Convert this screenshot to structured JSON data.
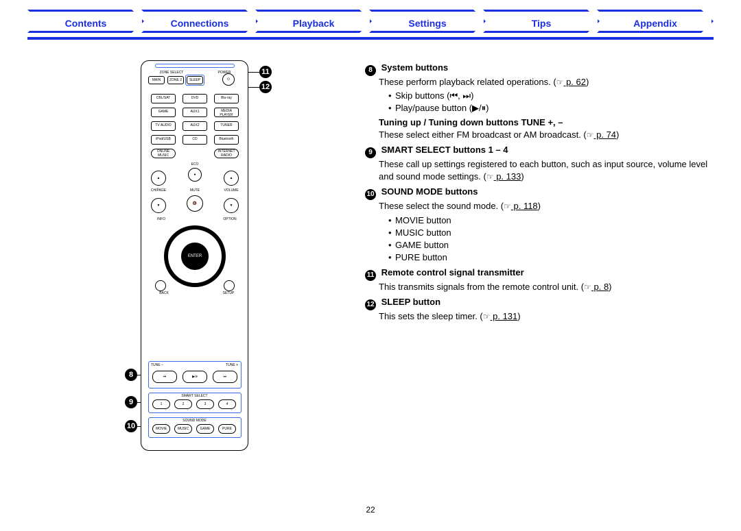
{
  "nav": {
    "contents": "Contents",
    "connections": "Connections",
    "playback": "Playback",
    "settings": "Settings",
    "tips": "Tips",
    "appendix": "Appendix"
  },
  "callout": {
    "n8": "8",
    "n9": "9",
    "n10": "10",
    "n11": "11",
    "n12": "12"
  },
  "desc": {
    "i8_title": "System buttons",
    "i8_line1a": "These perform playback related operations.  (",
    "i8_link": " p. 62",
    "i8_line1b": ")",
    "i8_b1": "Skip buttons (⏮, ⏭)",
    "i8_b2": "Play/pause button (▶/⏸)",
    "tune_title": "Tuning up / Tuning down buttons TUNE +, –",
    "tune_line_a": "These select either FM broadcast or AM broadcast.  (",
    "tune_link": " p. 74",
    "tune_line_b": ")",
    "i9_title": "SMART SELECT buttons 1 – 4",
    "i9_line_a": "These call up settings registered to each button, such as input source, volume level and sound mode settings.  (",
    "i9_link": " p. 133",
    "i9_line_b": ")",
    "i10_title": "SOUND MODE buttons",
    "i10_line_a": "These select the sound mode.  (",
    "i10_link": " p. 118",
    "i10_line_b": ")",
    "i10_b1": "MOVIE button",
    "i10_b2": "MUSIC button",
    "i10_b3": "GAME button",
    "i10_b4": "PURE button",
    "i11_title": "Remote control signal transmitter",
    "i11_line_a": "This transmits signals from the remote control unit.  (",
    "i11_link": " p. 8",
    "i11_line_b": ")",
    "i12_title": "SLEEP button",
    "i12_line_a": "This sets the sleep timer.  (",
    "i12_link": " p. 131",
    "i12_line_b": ")"
  },
  "remote": {
    "zone_select": "ZONE SELECT",
    "power": "POWER",
    "main": "MAIN",
    "zone2": "ZONE 2",
    "sleep": "SLEEP",
    "power_sym": "⏻",
    "src": {
      "r1": [
        "CBL/SAT",
        "DVD",
        "Blu-ray"
      ],
      "r2": [
        "GAME",
        "AUX1",
        "MEDIA PLAYER"
      ],
      "r3": [
        "TV AUDIO",
        "AUX2",
        "TUNER"
      ],
      "r4": [
        "iPod/USB",
        "CD",
        "Bluetooth"
      ],
      "r5": [
        "ONLINE MUSIC",
        "",
        "INTERNET RADIO"
      ]
    },
    "eco": "ECO",
    "chpage": "CH/PAGE",
    "mute": "MUTE",
    "volume": "VOLUME",
    "info": "INFO",
    "option": "OPTION",
    "enter": "ENTER",
    "back": "BACK",
    "setup": "SETUP",
    "tune_minus": "TUNE –",
    "tune_plus": "TUNE +",
    "skip_prev": "⏮",
    "playpause": "▶/⏸",
    "skip_next": "⏭",
    "smart": "SMART SELECT",
    "ss": [
      "1",
      "2",
      "3",
      "4"
    ],
    "sound_mode": "SOUND MODE",
    "sm": [
      "MOVIE",
      "MUSIC",
      "GAME",
      "PURE"
    ]
  },
  "page_number": "22",
  "hand": "☞"
}
